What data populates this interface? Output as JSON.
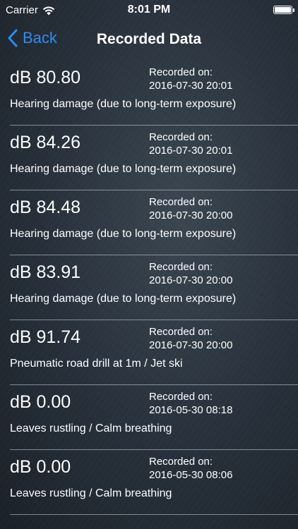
{
  "status_bar": {
    "carrier": "Carrier",
    "time": "8:01 PM",
    "icons": [
      "wifi-icon",
      "battery-icon"
    ]
  },
  "nav": {
    "back_label": "Back",
    "title": "Recorded Data",
    "accent_color": "#2f8cf0"
  },
  "records": [
    {
      "db": "dB 80.80",
      "label": "Recorded on:",
      "date": "2016-07-30 20:01",
      "description": "Hearing damage (due to long-term exposure)"
    },
    {
      "db": "dB 84.26",
      "label": "Recorded on:",
      "date": "2016-07-30 20:01",
      "description": "Hearing damage (due to long-term exposure)"
    },
    {
      "db": "dB 84.48",
      "label": "Recorded on:",
      "date": "2016-07-30 20:00",
      "description": "Hearing damage (due to long-term exposure)"
    },
    {
      "db": "dB 83.91",
      "label": "Recorded on:",
      "date": "2016-07-30 20:00",
      "description": "Hearing damage (due to long-term exposure)"
    },
    {
      "db": "dB 91.74",
      "label": "Recorded on:",
      "date": "2016-07-30 20:00",
      "description": "Pneumatic road drill at 1m / Jet ski"
    },
    {
      "db": "dB 0.00",
      "label": "Recorded on:",
      "date": "2016-05-30 08:18",
      "description": "Leaves rustling / Calm breathing"
    },
    {
      "db": "dB 0.00",
      "label": "Recorded on:",
      "date": "2016-05-30 08:06",
      "description": "Leaves rustling / Calm breathing"
    }
  ]
}
